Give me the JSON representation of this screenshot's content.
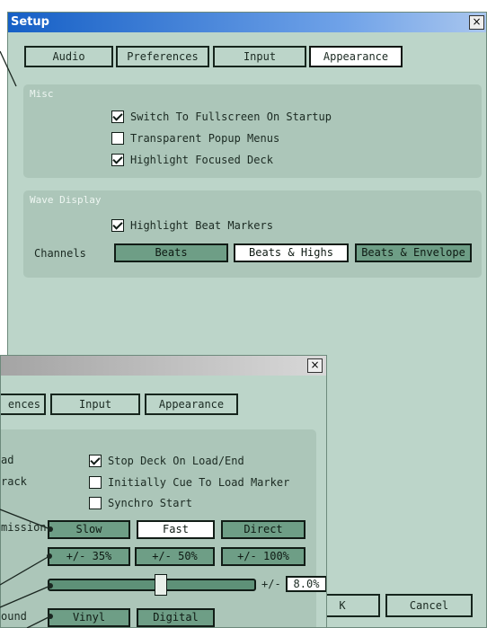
{
  "back_window": {
    "title": "Setup",
    "close_glyph": "×",
    "tabs": [
      "Audio",
      "Preferences",
      "Input",
      "Appearance"
    ],
    "active_tab": "Appearance",
    "misc": {
      "label": "Misc",
      "options": [
        {
          "label": "Switch To Fullscreen On Startup",
          "checked": true
        },
        {
          "label": "Transparent Popup Menus",
          "checked": false
        },
        {
          "label": "Highlight Focused Deck",
          "checked": true
        }
      ]
    },
    "wave_display": {
      "label": "Wave Display",
      "highlight_beat_markers": {
        "label": "Highlight Beat Markers",
        "checked": true
      },
      "channels_label": "Channels",
      "channels": [
        "Beats",
        "Beats & Highs",
        "Beats & Envelope"
      ],
      "channels_selected": "Beats & Highs"
    },
    "ok_label": "OK",
    "ok_visible_text": "K",
    "cancel_label": "Cancel"
  },
  "front_window": {
    "close_glyph": "×",
    "tabs": [
      "Preferences",
      "Input",
      "Appearance"
    ],
    "tabs_visible": [
      "ences",
      "Input",
      "Appearance"
    ],
    "partial_labels": [
      "ad",
      "rack",
      "mission",
      "ound"
    ],
    "options": [
      {
        "label": "Stop Deck On Load/End",
        "checked": true
      },
      {
        "label": "Initially Cue To Load Marker",
        "checked": false
      },
      {
        "label": "Synchro Start",
        "checked": false
      }
    ],
    "transmission": {
      "options": [
        "Slow",
        "Fast",
        "Direct"
      ],
      "selected": "Fast"
    },
    "range": {
      "options": [
        "+/- 35%",
        "+/- 50%",
        "+/- 100%"
      ],
      "selected": null
    },
    "pitch": {
      "prefix": "+/-",
      "value": "8.0%",
      "level": 0.5
    },
    "sound": {
      "options": [
        "Vinyl",
        "Digital"
      ],
      "selected": null
    }
  },
  "colors": {
    "window_bg": "#bcd5c9",
    "group_bg": "#acc6b9",
    "button_green": "#6e9e86",
    "title_active": "#1660c6",
    "title_inactive": "#a4a4a4"
  }
}
